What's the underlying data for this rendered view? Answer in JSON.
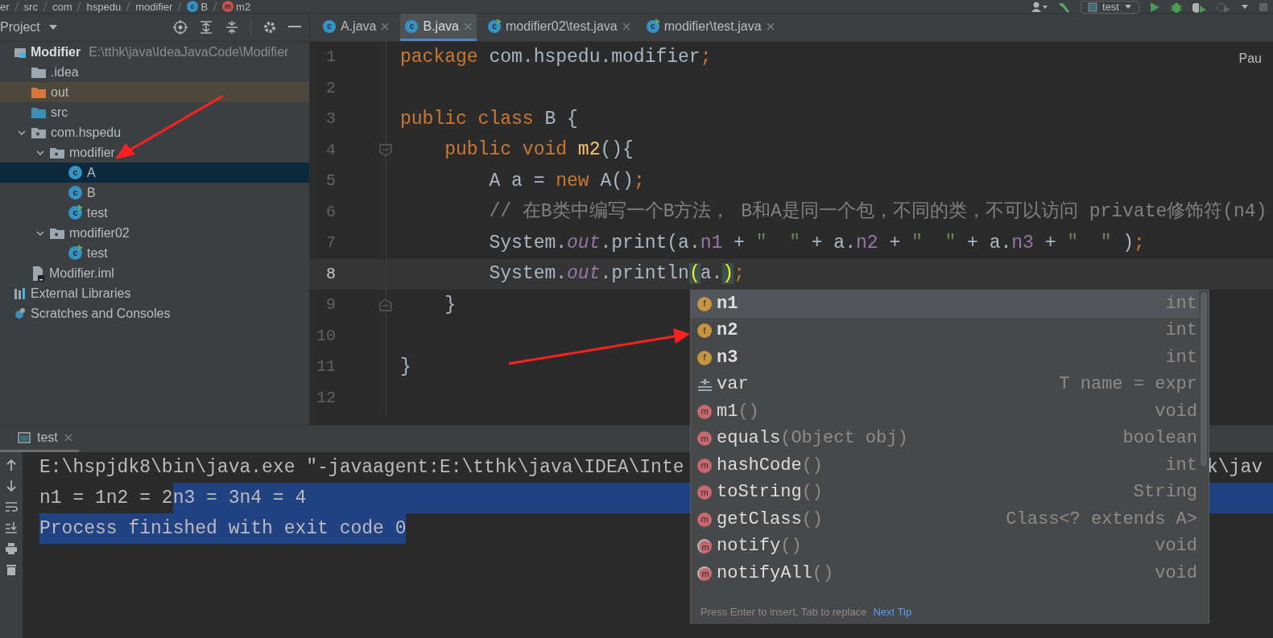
{
  "breadcrumbs": [
    {
      "label": "er",
      "kind": "plain"
    },
    {
      "label": "src",
      "kind": "plain"
    },
    {
      "label": "com",
      "kind": "plain"
    },
    {
      "label": "hspedu",
      "kind": "plain"
    },
    {
      "label": "modifier",
      "kind": "plain"
    },
    {
      "label": "B",
      "kind": "class",
      "badge": "c"
    },
    {
      "label": "m2",
      "kind": "method",
      "badge": "m"
    }
  ],
  "run_config": {
    "label": "test"
  },
  "project_panel": {
    "title": "Project"
  },
  "tabs": [
    {
      "label": "A.java",
      "kind": "class",
      "badge": "c",
      "selected": false
    },
    {
      "label": "B.java",
      "kind": "class",
      "badge": "c",
      "selected": true
    },
    {
      "label": "modifier02\\test.java",
      "kind": "runnable",
      "badge": "c",
      "selected": false
    },
    {
      "label": "modifier\\test.java",
      "kind": "runnable",
      "badge": "c",
      "selected": false
    }
  ],
  "tree": [
    {
      "label": "Modifier",
      "path": "E:\\tthk\\java\\IdeaJavaCode\\Modifier",
      "kind": "module",
      "selected": false,
      "children": [
        {
          "label": ".idea",
          "kind": "folder",
          "selected": false
        },
        {
          "label": "out",
          "kind": "folder-excluded",
          "selected": false
        },
        {
          "label": "src",
          "kind": "folder-source",
          "selected": false
        },
        {
          "label": "com.hspedu",
          "kind": "package",
          "expanded": true,
          "selected": false,
          "children": [
            {
              "label": "modifier",
              "kind": "package",
              "expanded": true,
              "selected": false,
              "children": [
                {
                  "label": "A",
                  "kind": "class",
                  "badge": "c",
                  "selected": true
                },
                {
                  "label": "B",
                  "kind": "class",
                  "badge": "c",
                  "selected": false
                },
                {
                  "label": "test",
                  "kind": "runnable",
                  "badge": "c",
                  "selected": false
                }
              ]
            },
            {
              "label": "modifier02",
              "kind": "package",
              "expanded": true,
              "selected": false,
              "children": [
                {
                  "label": "test",
                  "kind": "runnable",
                  "badge": "c",
                  "selected": false
                }
              ]
            }
          ]
        },
        {
          "label": "Modifier.iml",
          "kind": "iml",
          "selected": false
        }
      ]
    },
    {
      "label": "External Libraries",
      "kind": "libraries",
      "selected": false
    },
    {
      "label": "Scratches and Consoles",
      "kind": "scratches",
      "selected": false
    }
  ],
  "editor": {
    "corner_text": "Pau",
    "lines": [
      {
        "number": "1",
        "kind": "plain",
        "current": false,
        "tokens": [
          {
            "kind": "keyword",
            "text": "package"
          },
          {
            "kind": "plain",
            "text": " com.hspedu.modifier"
          },
          {
            "kind": "punct",
            "text": ";"
          }
        ]
      },
      {
        "number": "2",
        "kind": "plain",
        "current": false
      },
      {
        "number": "3",
        "kind": "plain",
        "current": false,
        "tokens": [
          {
            "kind": "keyword",
            "text": "public class"
          },
          {
            "kind": "plain",
            "text": " B {"
          }
        ]
      },
      {
        "number": "4",
        "kind": "fold-start",
        "current": false,
        "tokens": [
          {
            "kind": "keyword",
            "text": "    public void "
          },
          {
            "kind": "method",
            "text": "m2"
          },
          {
            "kind": "plain",
            "text": "(){"
          }
        ]
      },
      {
        "number": "5",
        "kind": "plain",
        "current": false,
        "tokens": [
          {
            "kind": "plain",
            "text": "        A a = "
          },
          {
            "kind": "keyword",
            "text": "new"
          },
          {
            "kind": "plain",
            "text": " A()"
          },
          {
            "kind": "punct",
            "text": ";"
          }
        ]
      },
      {
        "number": "6",
        "kind": "plain",
        "current": false,
        "tokens": [
          {
            "kind": "comment",
            "text": "        // 在B类中编写一个B方法， B和A是同一个包，不同的类，不可以访问 private修饰符(n4)"
          }
        ]
      },
      {
        "number": "7",
        "kind": "plain",
        "current": false,
        "tokens": [
          {
            "kind": "plain",
            "text": "        System."
          },
          {
            "kind": "static",
            "text": "out"
          },
          {
            "kind": "plain",
            "text": ".print(a."
          },
          {
            "kind": "field",
            "text": "n1"
          },
          {
            "kind": "plain",
            "text": " + "
          },
          {
            "kind": "string",
            "text": "\"  \""
          },
          {
            "kind": "plain",
            "text": " + a."
          },
          {
            "kind": "field",
            "text": "n2"
          },
          {
            "kind": "plain",
            "text": " + "
          },
          {
            "kind": "string",
            "text": "\"  \""
          },
          {
            "kind": "plain",
            "text": " + a."
          },
          {
            "kind": "field",
            "text": "n3"
          },
          {
            "kind": "plain",
            "text": " + "
          },
          {
            "kind": "string",
            "text": "\"  \""
          },
          {
            "kind": "plain",
            "text": " )"
          },
          {
            "kind": "punct",
            "text": ";"
          }
        ]
      },
      {
        "number": "8",
        "kind": "plain",
        "current": true,
        "tokens": [
          {
            "kind": "plain",
            "text": "        System."
          },
          {
            "kind": "static",
            "text": "out"
          },
          {
            "kind": "plain",
            "text": ".println"
          },
          {
            "kind": "match",
            "text": "("
          },
          {
            "kind": "plain",
            "text": "a."
          },
          {
            "kind": "match",
            "text": ")"
          },
          {
            "kind": "punct",
            "text": ";"
          }
        ]
      },
      {
        "number": "9",
        "kind": "fold-end",
        "current": false,
        "tokens": [
          {
            "kind": "plain",
            "text": "    }"
          }
        ]
      },
      {
        "number": "10",
        "kind": "plain",
        "current": false
      },
      {
        "number": "11",
        "kind": "plain",
        "current": false,
        "tokens": [
          {
            "kind": "plain",
            "text": "}"
          }
        ]
      },
      {
        "number": "12",
        "kind": "plain",
        "current": false
      }
    ]
  },
  "completion": {
    "items": [
      {
        "kind": "field",
        "badge": "f",
        "name": "n1",
        "type": "int",
        "selected": true
      },
      {
        "kind": "field",
        "badge": "f",
        "name": "n2",
        "type": "int",
        "selected": false
      },
      {
        "kind": "field",
        "badge": "f",
        "name": "n3",
        "type": "int",
        "selected": false
      },
      {
        "kind": "template",
        "name": "var",
        "type": "T name = expr",
        "selected": false
      },
      {
        "kind": "method",
        "badge": "m",
        "name": "m1",
        "params": "()",
        "type": "void",
        "selected": false
      },
      {
        "kind": "method",
        "badge": "m",
        "name": "equals",
        "params": "(Object obj)",
        "type": "boolean",
        "selected": false
      },
      {
        "kind": "method",
        "badge": "m",
        "name": "hashCode",
        "params": "()",
        "type": "int",
        "selected": false
      },
      {
        "kind": "method",
        "badge": "m",
        "name": "toString",
        "params": "()",
        "type": "String",
        "selected": false
      },
      {
        "kind": "method",
        "badge": "m",
        "name": "getClass",
        "params": "()",
        "type": "Class<? extends A>",
        "selected": false
      },
      {
        "kind": "method-locked",
        "badge": "m",
        "name": "notify",
        "params": "()",
        "type": "void",
        "selected": false
      },
      {
        "kind": "method-locked",
        "badge": "m",
        "name": "notifyAll",
        "params": "()",
        "type": "void",
        "selected": false
      }
    ],
    "footer": "Press Enter to insert, Tab to replace",
    "link": "Next Tip"
  },
  "run_panel": {
    "tab": "test",
    "lines": [
      {
        "segments": [
          {
            "text": "E:\\hspjdk8\\bin\\java.exe \"-javaagent:E:\\tthk\\java\\IDEA\\Inte",
            "selected": false
          }
        ],
        "tail": "k\\jav"
      },
      {
        "segments": [
          {
            "text": "n1 = 1n2 = 2",
            "selected": false
          },
          {
            "text": "n3 = 3n4 = 4",
            "selected": true
          }
        ],
        "selection_to_end": true
      },
      {
        "segments": [
          {
            "text": "Process finished with exit code 0",
            "selected": true
          }
        ]
      }
    ]
  }
}
